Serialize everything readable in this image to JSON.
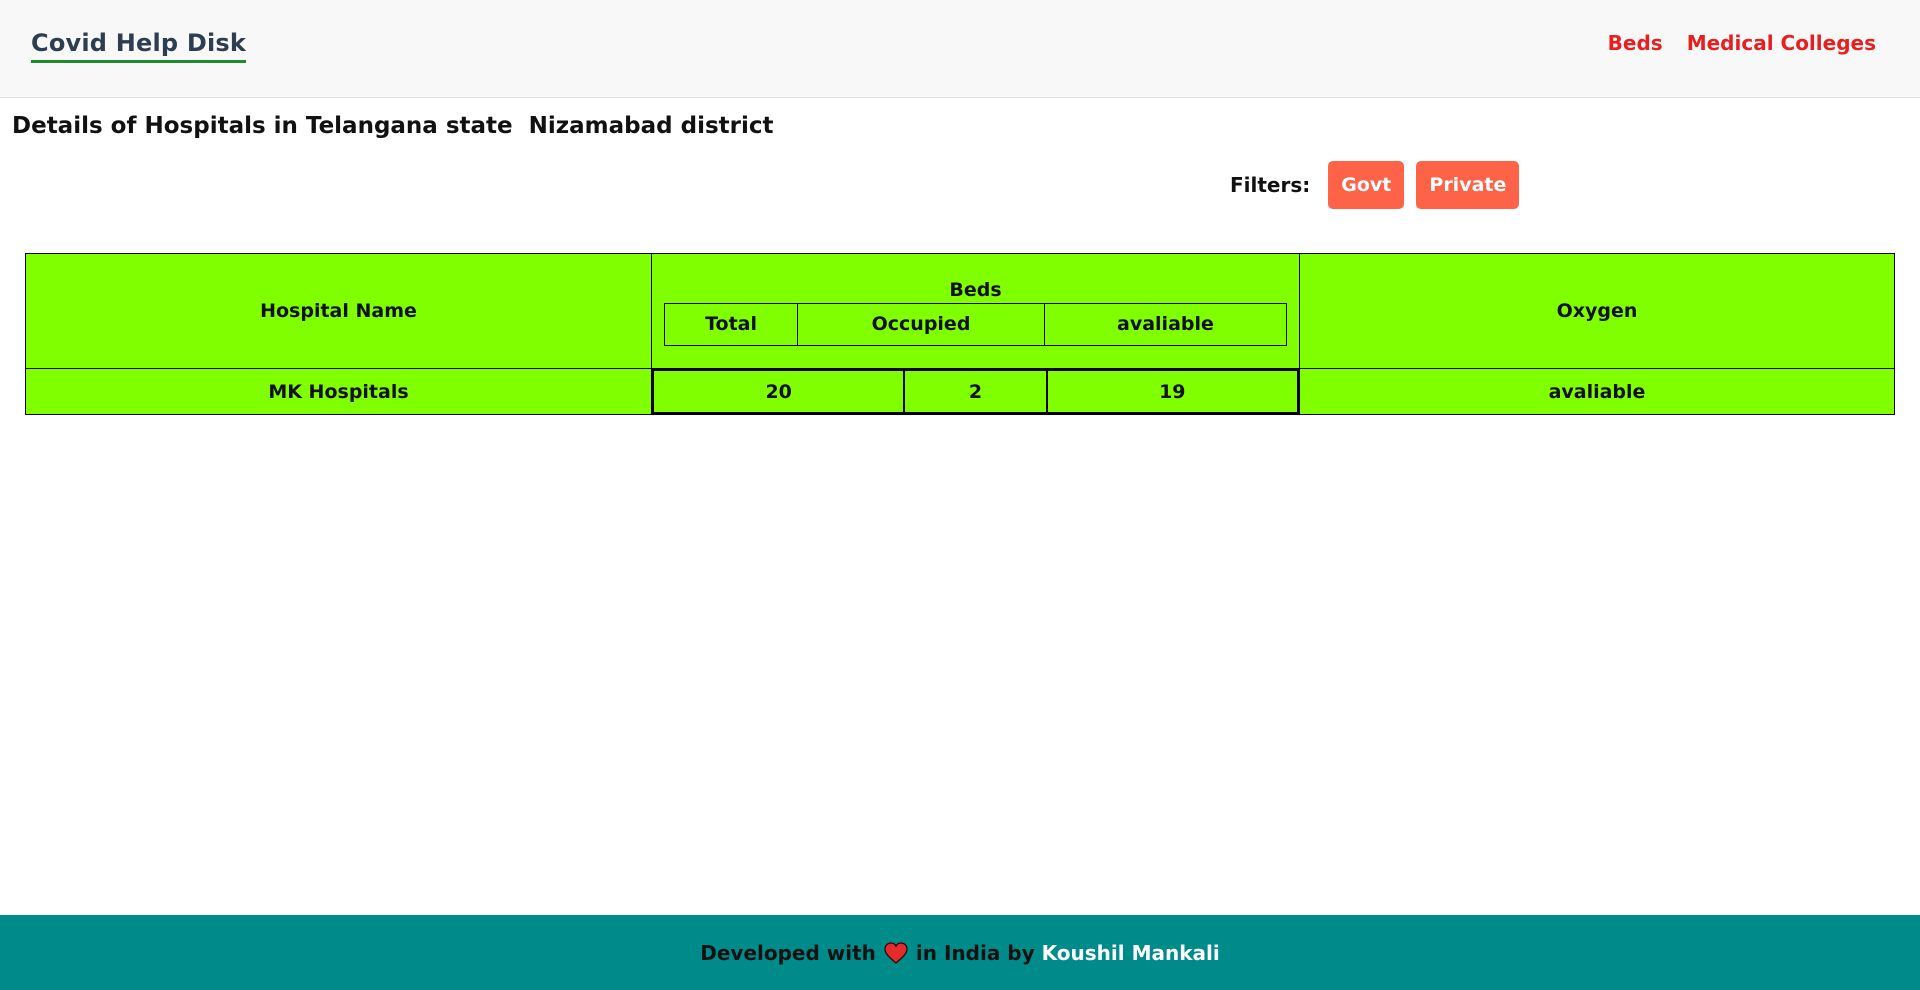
{
  "navbar": {
    "brand": "Covid Help Disk",
    "links": [
      {
        "label": "Beds"
      },
      {
        "label": "Medical Colleges"
      }
    ]
  },
  "page": {
    "title": "Details of Hospitals in Telangana state  Nizamabad district"
  },
  "filters": {
    "label": "Filters:",
    "buttons": [
      "Govt",
      "Private"
    ],
    "button_color": "#ff6347"
  },
  "table": {
    "headers": {
      "hospital_name": "Hospital Name",
      "beds": "Beds",
      "beds_sub": [
        "Total",
        "Occupied",
        "avaliable"
      ],
      "oxygen": "Oxygen"
    },
    "rows": [
      {
        "hospital_name": "MK Hospitals",
        "total": "20",
        "occupied": "2",
        "available": "19",
        "oxygen": "avaliable"
      }
    ],
    "background_color": "#7fff00"
  },
  "footer": {
    "text_before": "Developed with",
    "icon": "heart-icon",
    "text_after": "in India by",
    "author": "Koushil Mankali",
    "background_color": "#008b8b"
  }
}
